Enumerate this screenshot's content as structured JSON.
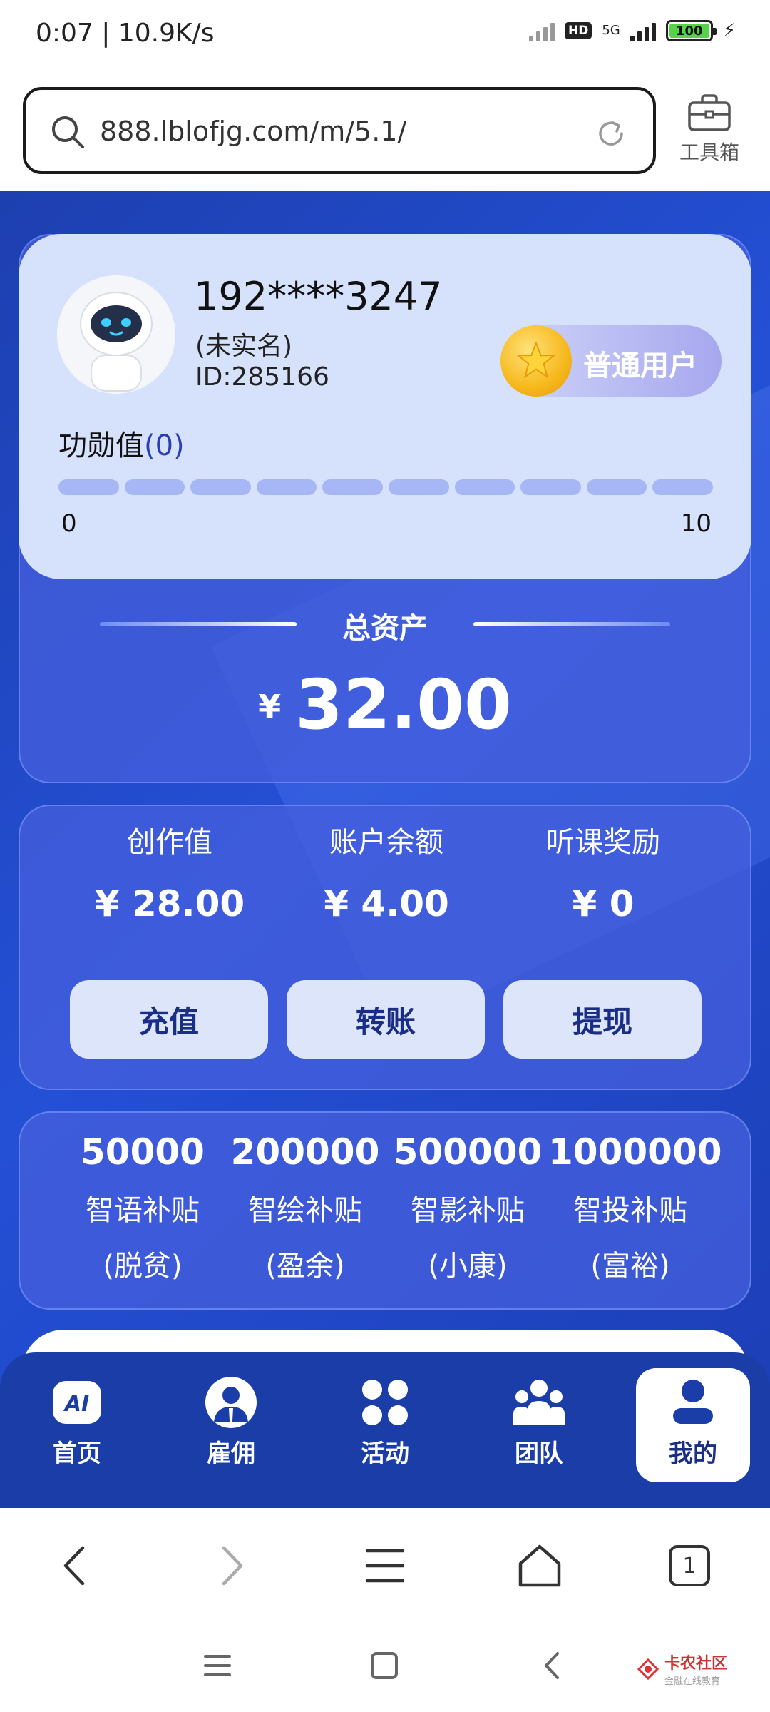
{
  "status_bar": {
    "time_speed": "0:07 | 10.9K/s",
    "hd": "HD",
    "network": "5G",
    "battery": "100"
  },
  "browser": {
    "url": "888.lblofjg.com/m/5.1/",
    "toolbox_label": "工具箱",
    "tab_count": "1"
  },
  "user": {
    "phone": "192****3247",
    "realname_status": "(未实名)",
    "id": "ID:285166",
    "level_badge": "普通用户",
    "merit_label": "功勋值",
    "merit_value": "(0)",
    "progress_min": "0",
    "progress_max": "10",
    "progress_fraction": 0
  },
  "assets": {
    "title": "总资产",
    "currency": "¥",
    "amount": "32.00"
  },
  "wallet": {
    "items": [
      {
        "label": "创作值",
        "value": "¥ 28.00"
      },
      {
        "label": "账户余额",
        "value": "¥ 4.00"
      },
      {
        "label": "听课奖励",
        "value": "¥ 0"
      }
    ],
    "buttons": [
      "充值",
      "转账",
      "提现"
    ]
  },
  "subsidies": [
    {
      "amount": "50000",
      "name": "智语补贴",
      "level": "(脱贫)"
    },
    {
      "amount": "200000",
      "name": "智绘补贴",
      "level": "(盈余)"
    },
    {
      "amount": "500000",
      "name": "智影补贴",
      "level": "(小康)"
    },
    {
      "amount": "1000000",
      "name": "智投补贴",
      "level": "(富裕)"
    }
  ],
  "tabbar": {
    "tabs": [
      "首页",
      "雇佣",
      "活动",
      "团队",
      "我的"
    ],
    "ai_icon_text": "AI",
    "active": "我的"
  },
  "watermark": {
    "main": "卡农社区",
    "sub": "金融在线教育"
  },
  "colors": {
    "primary_blue": "#2450d6",
    "card_light": "#d6e1fb",
    "button_text": "#1b2e86",
    "badge_gold": "#f6b81c"
  }
}
